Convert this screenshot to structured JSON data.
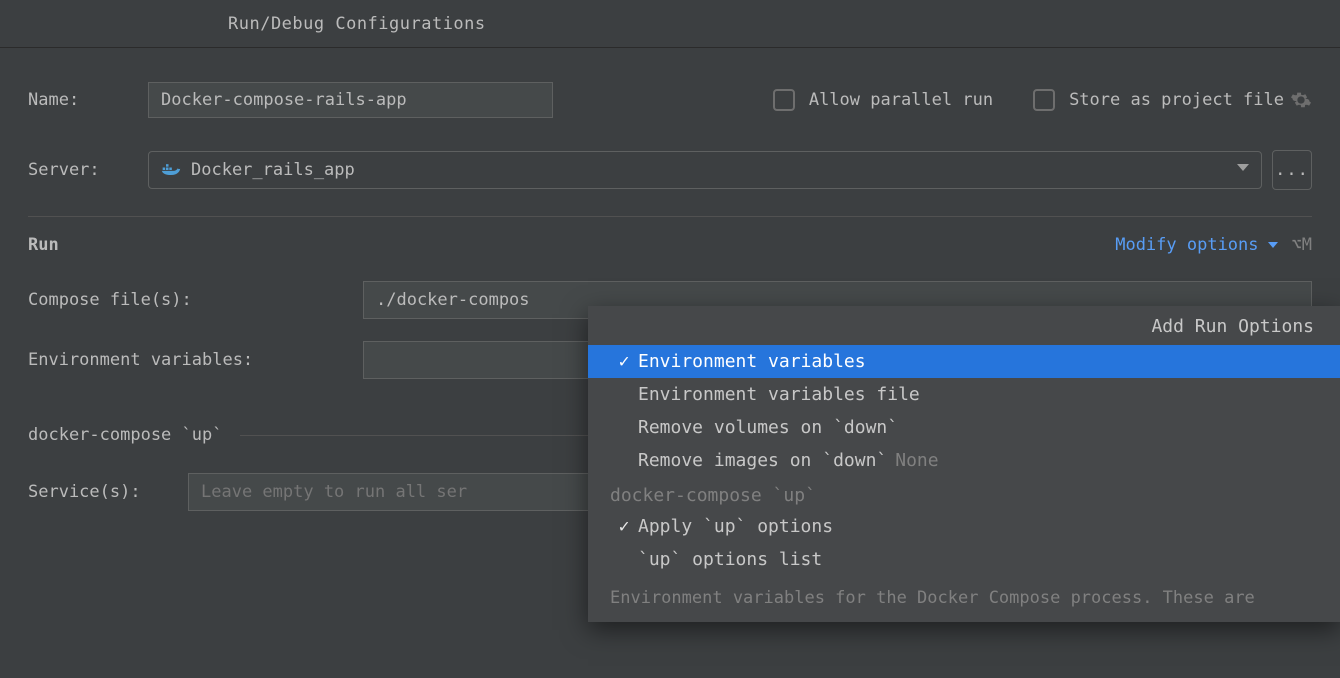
{
  "title": "Run/Debug Configurations",
  "name": {
    "label": "Name:",
    "value": "Docker-compose-rails-app"
  },
  "allow_parallel": {
    "label": "Allow parallel run"
  },
  "store_project": {
    "label": "Store as project file"
  },
  "server": {
    "label": "Server:",
    "value": "Docker_rails_app"
  },
  "run_section": {
    "title": "Run",
    "modify_label": "Modify options",
    "shortcut": "⌥M",
    "compose_files": {
      "label": "Compose file(s):",
      "value": "./docker-compos"
    },
    "env_vars": {
      "label": "Environment variables:",
      "value": ""
    }
  },
  "up_section": {
    "title": "docker-compose `up`"
  },
  "services": {
    "label": "Service(s):",
    "placeholder": "Leave empty to run all ser"
  },
  "popup": {
    "header": "Add Run Options",
    "items": [
      {
        "checked": true,
        "label": "Environment variables",
        "selected": true
      },
      {
        "checked": false,
        "label": "Environment variables file"
      },
      {
        "checked": false,
        "label": "Remove volumes on `down`"
      },
      {
        "checked": false,
        "label": "Remove images on `down`",
        "suffix": "None"
      }
    ],
    "group_label": "docker-compose `up`",
    "group_items": [
      {
        "checked": true,
        "label": "Apply `up` options"
      },
      {
        "checked": false,
        "label": "`up` options list"
      }
    ],
    "footer": "Environment variables for the Docker Compose process. These are"
  }
}
